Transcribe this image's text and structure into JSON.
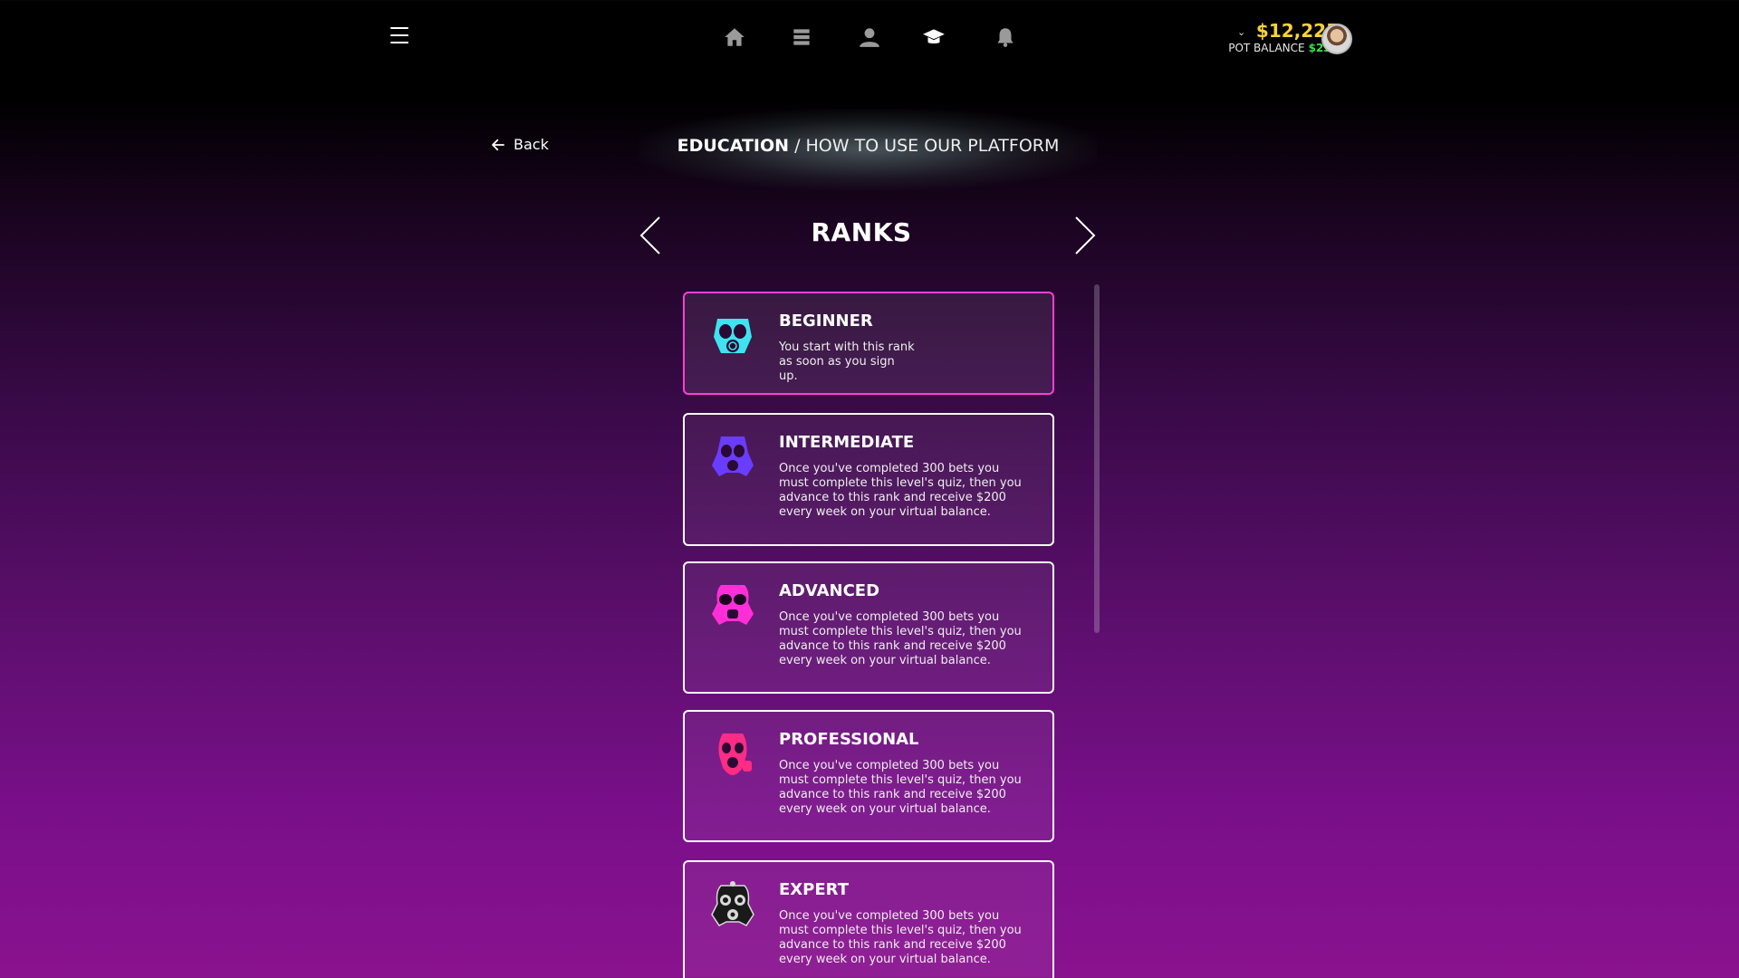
{
  "nav": {
    "icons": [
      "home-icon",
      "list-icon",
      "user-icon",
      "graduation-cap-icon",
      "bell-icon"
    ]
  },
  "balance": {
    "amount": "$12,225",
    "pot_label": "POT BALANCE",
    "pot_value": "$235"
  },
  "back_label": "Back",
  "breadcrumb": {
    "section": "EDUCATION",
    "separator": " / ",
    "page": "HOW TO USE OUR PLATFORM"
  },
  "heading": "RANKS",
  "ranks": [
    {
      "title": "BEGINNER",
      "description": "You start with this rank as soon as you sign up.",
      "icon": "gas-mask-cyan-icon",
      "color": "#3fe3f0"
    },
    {
      "title": "INTERMEDIATE",
      "description": "Once you've completed 300 bets you must complete this level's quiz, then you advance to this rank and receive $200 every week on your virtual balance.",
      "icon": "gas-mask-blue-icon",
      "color": "#6a3cff"
    },
    {
      "title": "ADVANCED",
      "description": "Once you've completed 300 bets you must complete this level's quiz, then you advance to this rank and receive $200 every week on your virtual balance.",
      "icon": "gas-mask-magenta-icon",
      "color": "#ff2fd8"
    },
    {
      "title": "PROFESSIONAL",
      "description": "Once you've completed 300 bets you must complete this level's quiz, then you advance to this rank and receive $200 every week on your virtual balance.",
      "icon": "gas-mask-pink-icon",
      "color": "#ff2c86"
    },
    {
      "title": "EXPERT",
      "description": "Once you've completed 300 bets you must complete this level's quiz, then you advance to this rank and receive $200 every week on your virtual balance.",
      "icon": "gas-mask-skull-icon",
      "color": "#d9d9d9"
    }
  ]
}
